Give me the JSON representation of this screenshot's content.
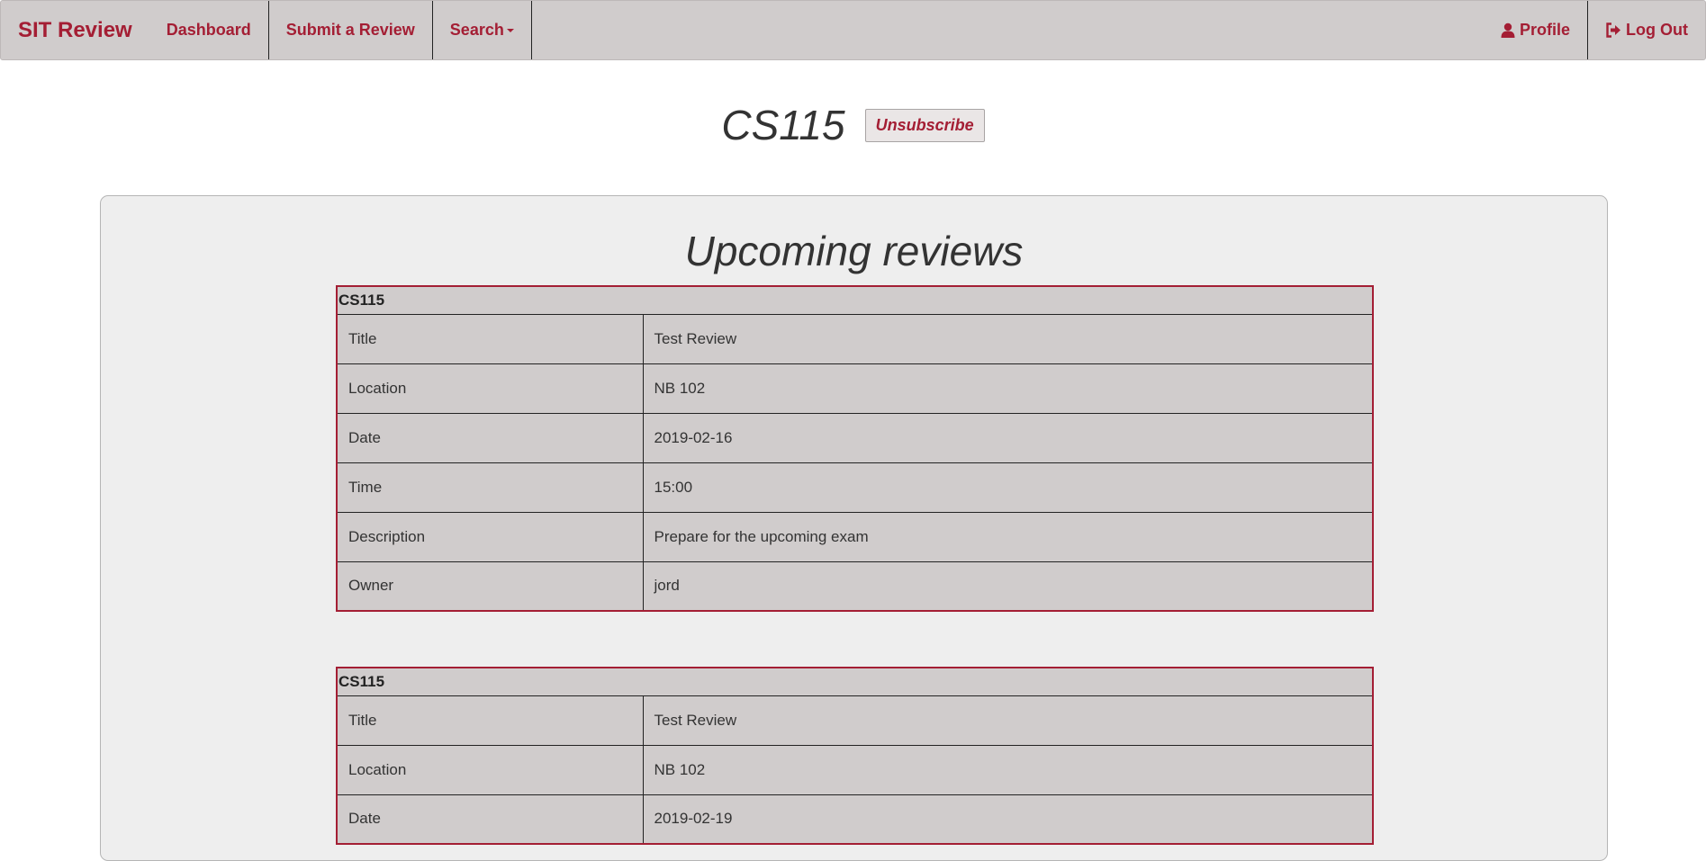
{
  "nav": {
    "brand": "SIT Review",
    "dashboard": "Dashboard",
    "submit": "Submit a Review",
    "search": "Search",
    "profile": "Profile",
    "logout": "Log Out"
  },
  "course": {
    "title": "CS115",
    "unsubscribe": "Unsubscribe"
  },
  "panel": {
    "heading": "Upcoming reviews"
  },
  "reviews": [
    {
      "course": "CS115",
      "rows": [
        {
          "label": "Title",
          "value": "Test Review"
        },
        {
          "label": "Location",
          "value": "NB 102"
        },
        {
          "label": "Date",
          "value": "2019-02-16"
        },
        {
          "label": "Time",
          "value": "15:00"
        },
        {
          "label": "Description",
          "value": "Prepare for the upcoming exam"
        },
        {
          "label": "Owner",
          "value": "jord"
        }
      ]
    },
    {
      "course": "CS115",
      "rows": [
        {
          "label": "Title",
          "value": "Test Review"
        },
        {
          "label": "Location",
          "value": "NB 102"
        },
        {
          "label": "Date",
          "value": "2019-02-19"
        }
      ]
    }
  ],
  "colors": {
    "accent": "#a41e34",
    "navbar": "#d0cccc",
    "panel": "#eeeeee"
  }
}
